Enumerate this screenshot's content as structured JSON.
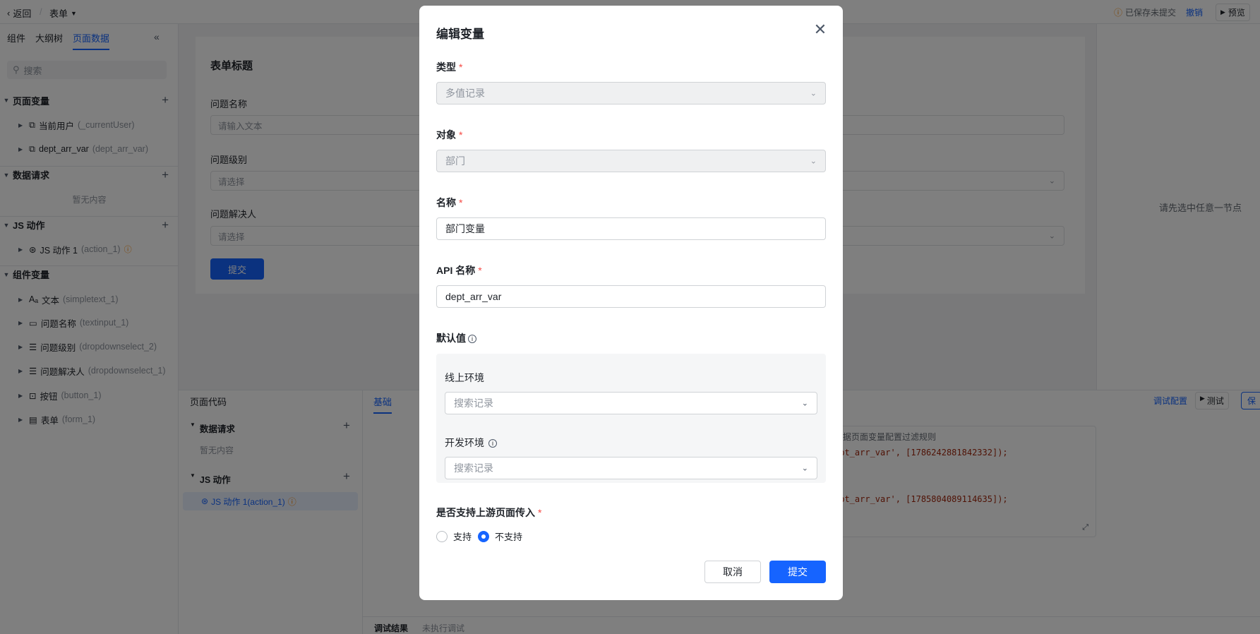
{
  "topbar": {
    "back": "返回",
    "doc_title": "表单",
    "save_status": "已保存未提交",
    "undo": "撤销",
    "preview": "预览"
  },
  "left": {
    "tabs": [
      "组件",
      "大纲树",
      "页面数据"
    ],
    "search_placeholder": "搜索",
    "page_vars": {
      "title": "页面变量",
      "items": [
        {
          "name": "当前用户",
          "api": "(_currentUser)"
        },
        {
          "name": "dept_arr_var",
          "api": "(dept_arr_var)"
        }
      ]
    },
    "data_requests": {
      "title": "数据请求",
      "empty": "暂无内容"
    },
    "js_actions": {
      "title": "JS 动作",
      "items": [
        {
          "name": "JS 动作 1",
          "api": "(action_1)"
        }
      ]
    },
    "comp_vars": {
      "title": "组件变量",
      "items": [
        {
          "name": "文本",
          "api": "(simpletext_1)"
        },
        {
          "name": "问题名称",
          "api": "(textinput_1)"
        },
        {
          "name": "问题级别",
          "api": "(dropdownselect_2)"
        },
        {
          "name": "问题解决人",
          "api": "(dropdownselect_1)"
        },
        {
          "name": "按钮",
          "api": "(button_1)"
        },
        {
          "name": "表单",
          "api": "(form_1)"
        }
      ]
    }
  },
  "form": {
    "title": "表单标题",
    "q1_label": "问题名称",
    "q1_placeholder": "请输入文本",
    "q2_label": "问题级别",
    "q2_placeholder": "请选择",
    "q3_label": "问题解决人",
    "q3_placeholder": "请选择",
    "submit": "提交"
  },
  "right": {
    "hint": "请先选中任意一节点"
  },
  "bottom": {
    "page_code": "页面代码",
    "data_requests": "数据请求",
    "empty": "暂无内容",
    "js_actions": "JS 动作",
    "js_item": "JS 动作 1(action_1)",
    "tab_basic": "基础",
    "debug_config": "调试配置",
    "test": "测试",
    "save": "保",
    "code_line1": "根据页面变量配置过滤规则",
    "code_line2": "ept_arr_var', [1786242881842332]);",
    "code_line3": "ept_arr_var', [1785804089114635]);",
    "debug_result": "调试结果",
    "not_run": "未执行调试"
  },
  "modal": {
    "title": "编辑变量",
    "type_label": "类型",
    "type_value": "多值记录",
    "object_label": "对象",
    "object_value": "部门",
    "name_label": "名称",
    "name_value": "部门变量",
    "api_label": "API 名称",
    "api_value": "dept_arr_var",
    "default_label": "默认值",
    "online_env": "线上环境",
    "online_placeholder": "搜索记录",
    "dev_env": "开发环境",
    "dev_placeholder": "搜索记录",
    "upstream_label": "是否支持上游页面传入",
    "opt_yes": "支持",
    "opt_no": "不支持",
    "cancel": "取消",
    "submit": "提交"
  }
}
